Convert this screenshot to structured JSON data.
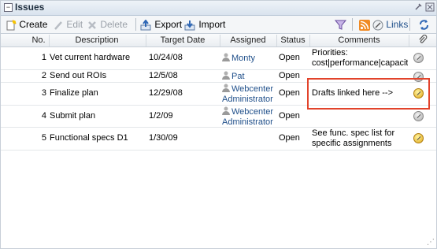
{
  "panel": {
    "title": "Issues"
  },
  "toolbar": {
    "create": "Create",
    "edit": "Edit",
    "delete": "Delete",
    "export": "Export",
    "import": "Import",
    "links": "Links"
  },
  "table": {
    "columns": [
      "No.",
      "Description",
      "Target Date",
      "Assigned",
      "Status",
      "Comments"
    ],
    "rows": [
      {
        "no": "1",
        "description": "Vet current hardware",
        "target_date": "10/24/08",
        "assigned_line1": "Monty",
        "assigned_line2": "",
        "status": "Open",
        "comments_line1": "Priorities:",
        "comments_line2": "cost|performance|capacit",
        "attachment": "grey"
      },
      {
        "no": "2",
        "description": "Send out ROIs",
        "target_date": "12/5/08",
        "assigned_line1": "Pat",
        "assigned_line2": "",
        "status": "Open",
        "comments_line1": "",
        "comments_line2": "",
        "attachment": "grey"
      },
      {
        "no": "3",
        "description": "Finalize plan",
        "target_date": "12/29/08",
        "assigned_line1": "Webcenter",
        "assigned_line2": "Administrator",
        "status": "Open",
        "comments_line1": "Drafts linked here -->",
        "comments_line2": "",
        "attachment": "gold"
      },
      {
        "no": "4",
        "description": "Submit plan",
        "target_date": "1/2/09",
        "assigned_line1": "Webcenter",
        "assigned_line2": "Administrator",
        "status": "Open",
        "comments_line1": "",
        "comments_line2": "",
        "attachment": "grey"
      },
      {
        "no": "5",
        "description": "Functional specs D1",
        "target_date": "1/30/09",
        "assigned_line1": "",
        "assigned_line2": "",
        "status": "Open",
        "comments_line1": "See func. spec list for",
        "comments_line2": "specific assignments",
        "attachment": "gold"
      }
    ]
  },
  "colors": {
    "highlight": "#e2432b",
    "link": "#1f4f8a",
    "header_bg": "#dfe7f0"
  },
  "icons": [
    "collapse-icon",
    "pin-icon",
    "close-icon",
    "create-icon",
    "edit-icon",
    "delete-icon",
    "export-icon",
    "import-icon",
    "filter-icon",
    "rss-icon",
    "links-icon",
    "refresh-icon",
    "paperclip-icon",
    "person-icon",
    "attachment-icon"
  ]
}
